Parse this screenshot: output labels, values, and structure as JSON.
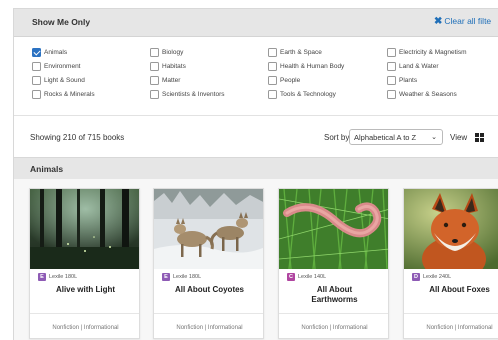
{
  "filter_panel": {
    "title": "Show Me Only",
    "clear_all_label": "Clear all filte"
  },
  "filters": [
    {
      "label": "Animals",
      "checked": true
    },
    {
      "label": "Environment",
      "checked": false
    },
    {
      "label": "Light & Sound",
      "checked": false
    },
    {
      "label": "Rocks & Minerals",
      "checked": false
    },
    {
      "label": "Biology",
      "checked": false
    },
    {
      "label": "Habitats",
      "checked": false
    },
    {
      "label": "Matter",
      "checked": false
    },
    {
      "label": "Scientists & Inventors",
      "checked": false
    },
    {
      "label": "Earth & Space",
      "checked": false
    },
    {
      "label": "Health & Human Body",
      "checked": false
    },
    {
      "label": "People",
      "checked": false
    },
    {
      "label": "Tools & Technology",
      "checked": false
    },
    {
      "label": "Electricity & Magnetism",
      "checked": false
    },
    {
      "label": "Land & Water",
      "checked": false
    },
    {
      "label": "Plants",
      "checked": false
    },
    {
      "label": "Weather & Seasons",
      "checked": false
    }
  ],
  "toolbar": {
    "showing_text": "Showing 210 of 715 books",
    "sort_label": "Sort by",
    "sort_value": "Alphabetical A to Z",
    "view_label": "View"
  },
  "section": {
    "title": "Animals"
  },
  "books": [
    {
      "level": "E",
      "level_color": "#8e5bb5",
      "lexile": "Lexile 180L",
      "title": "Alive with Light",
      "type": "Nonfiction | Informational"
    },
    {
      "level": "E",
      "level_color": "#8e5bb5",
      "lexile": "Lexile 180L",
      "title": "All About Coyotes",
      "type": "Nonfiction | Informational"
    },
    {
      "level": "C",
      "level_color": "#b045a0",
      "lexile": "Lexile 140L",
      "title": "All About Earthworms",
      "type": "Nonfiction | Informational"
    },
    {
      "level": "D",
      "level_color": "#8e5bb5",
      "lexile": "Lexile 240L",
      "title": "All About Foxes",
      "type": "Nonfiction | Informational"
    }
  ]
}
